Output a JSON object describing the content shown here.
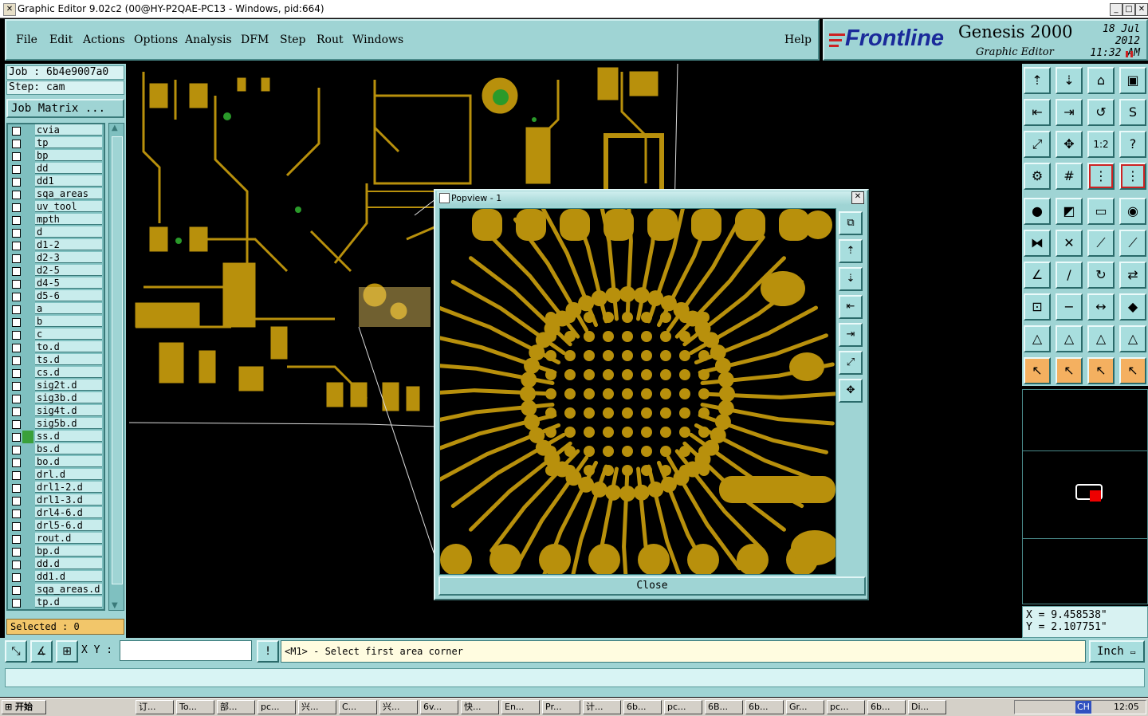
{
  "window": {
    "title": "Graphic Editor 9.02c2 (00@HY-P2QAE-PC13 - Windows, pid:664)"
  },
  "menu": [
    "File",
    "Edit",
    "Actions",
    "Options",
    "Analysis",
    "DFM",
    "Step",
    "Rout",
    "Windows"
  ],
  "help_label": "Help",
  "logo": {
    "brand": "Frontline",
    "product": "Genesis 2000",
    "subtitle": "Graphic Editor",
    "date": "18 Jul 2012",
    "time": "11:32  AM"
  },
  "left": {
    "job": "Job : 6b4e9007a0",
    "step": "Step: cam",
    "job_matrix": "Job Matrix ...",
    "layers": [
      "cvia",
      "tp",
      "bp",
      "dd",
      "dd1",
      "sqa_areas",
      "uv_tool",
      "mpth",
      "d",
      "d1-2",
      "d2-3",
      "d2-5",
      "d4-5",
      "d5-6",
      "a",
      "b",
      "c",
      "to.d",
      "ts.d",
      "cs.d",
      "sig2t.d",
      "sig3b.d",
      "sig4t.d",
      "sig5b.d",
      "ss.d",
      "bs.d",
      "bo.d",
      "drl.d",
      "drl1-2.d",
      "drl1-3.d",
      "drl4-6.d",
      "drl5-6.d",
      "rout.d",
      "bp.d",
      "dd.d",
      "dd1.d",
      "sqa_areas.d",
      "tp.d"
    ],
    "active_layer": "ss.d",
    "selected": "Selected : 0"
  },
  "popview": {
    "title": "Popview - 1",
    "close_label": "Close"
  },
  "coords": {
    "x": "X = 9.458538\"",
    "y": "Y = 2.107751\""
  },
  "bottom": {
    "xy_label": "X Y :",
    "xy_value": "",
    "message": "<M1> - Select first area corner",
    "unit": "Inch"
  },
  "taskbar": {
    "start": "开始",
    "tasks": [
      "订...",
      "To...",
      "部...",
      "pc...",
      "兴...",
      "C...",
      "兴...",
      "6v...",
      "快...",
      "En...",
      "Pr...",
      "计...",
      "6b...",
      "pc...",
      "6B...",
      "6b...",
      "Gr...",
      "pc...",
      "6b...",
      "Di..."
    ],
    "clock": "12:05",
    "tray_lang": "CH"
  },
  "colors": {
    "panel": "#9fd4d4",
    "copper": "#b8900c",
    "background": "#000000",
    "accent_orange": "#f4b060"
  }
}
